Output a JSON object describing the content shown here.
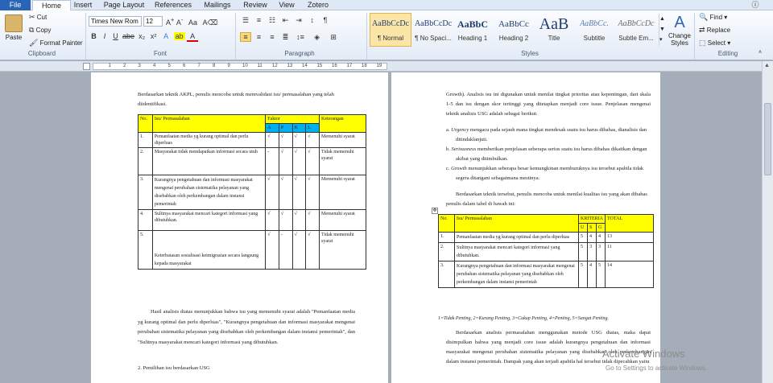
{
  "tabs": [
    "File",
    "Home",
    "Insert",
    "Page Layout",
    "References",
    "Mailings",
    "Review",
    "View",
    "Zotero"
  ],
  "clipboard": {
    "paste": "Paste",
    "cut": "Cut",
    "copy": "Copy",
    "format_painter": "Format Painter",
    "label": "Clipboard"
  },
  "font": {
    "name": "Times New Rom",
    "size": "12",
    "label": "Font"
  },
  "paragraph": {
    "label": "Paragraph"
  },
  "styles": {
    "items": [
      {
        "preview": "AaBbCcDc",
        "name": "¶ Normal"
      },
      {
        "preview": "AaBbCcDc",
        "name": "¶ No Spaci..."
      },
      {
        "preview": "AaBbC",
        "name": "Heading 1"
      },
      {
        "preview": "AaBbCc",
        "name": "Heading 2"
      },
      {
        "preview": "AaB",
        "name": "Title"
      },
      {
        "preview": "AaBbCc.",
        "name": "Subtitle"
      },
      {
        "preview": "AaBbCcDc",
        "name": "Subtle Em..."
      }
    ],
    "change": "Change Styles",
    "label": "Styles"
  },
  "editing": {
    "find": "Find",
    "replace": "Replace",
    "select": "Select",
    "label": "Editing"
  },
  "left_page": {
    "intro": "Berdasarkan  teknik AKPL, penulis mencoba untuk memvalidasi isu/ permasalahan yang telah diidentifikasi.",
    "table": {
      "headers": [
        "No.",
        "Isu/ Permasalahan",
        "Faktor",
        "Keterangan"
      ],
      "factors": [
        "A",
        "P",
        "K",
        "L"
      ],
      "rows": [
        {
          "no": "1.",
          "issue": "Pemanfaatan  media yg kurang  optimal dan perlu diperluas",
          "marks": [
            "√",
            "√",
            "√",
            "√"
          ],
          "note": "Memenuhi syarat"
        },
        {
          "no": "2.",
          "issue": "Masyarakat  tidak mendapatkan  informasi secara  utuh",
          "marks": [
            "-",
            "√",
            "√",
            "√"
          ],
          "note": "Tidak memenuhi syarat"
        },
        {
          "no": "3.",
          "issue": "Kurangnya pengetahuan  dan informasi masyarakat  mengenai  perubahan sistematika pelayanan  yang disebabkan oleh perkembangan  dalam  instansi pemerintah",
          "marks": [
            "√",
            "√",
            "√",
            "√"
          ],
          "note": "Memenuhi syarat"
        },
        {
          "no": "4.",
          "issue": "Sulitnya masyarakat  mencari  kategori informasi  yang dibutuhkan.",
          "marks": [
            "√",
            "√",
            "√",
            "√"
          ],
          "note": "Memenuhi syarat"
        },
        {
          "no": "5.",
          "issue": "Keterbatasan  sosialisasi keimigrasian secara  langsung kepada  masyarakat",
          "marks": [
            "√",
            "-",
            "√",
            "√"
          ],
          "note": "Tidak memenuhi syarat"
        }
      ]
    },
    "analysis": "Hasil  analisis  diatas  menunjukkan  bahwa  isu  yang  memenuhi  syarat  adalah \"Pemanfaatan media yg kurang optimal dan perlu diperluas\", \"Kurangnya pengetahuan dan informasi masyarakat mengenai perubahan sistematika pelayanan yang disebabkan oleh perkembangan dalam instansi pemerintah\", dan  \"Sulitnya masyarakat mencari kategori informasi yang dibutuhkan.",
    "heading": "2.   Pemilihan isu berdasarkan  USG"
  },
  "right_page": {
    "intro": "Growth). Analisis isu ini digunakan untuk menilai tingkat prioritas atau kepentingan, dari skala 1-5 dan isu dengan skor tertinggi yang ditetapkan menjadi core issue. Penjelasan mengenai teknik analisis USG adalah sebagai berikut:",
    "list": [
      {
        "marker": "a.",
        "term": "Urgency",
        "text": " mengacu pada sejauh mana tingkat mendesak suatu isu harus dibahas, dianalisis dan ditindaklanjuti."
      },
      {
        "marker": "b.",
        "term": "Seriousness",
        "text": " memberikan penjelasan seberapa serius suatu isu harus dibahas dikaitkan dengan akibat yang ditimbulkan."
      },
      {
        "marker": "c.",
        "term": "Growth",
        "text": " menunjukkan seberapa besar kemungkinan memburuknya isu tersebut apabila tidak segera ditangani sebagaimana mestinya."
      }
    ],
    "para2": "Berdasarkan  teknik tersebut,  penulis mencoba  untuk menilai kualitas  isu yang akan dibahas penulis dalam tabel di bawah ini:",
    "table": {
      "headers": [
        "No.",
        "Isu/ Permasalahan",
        "KRITERIA",
        "TOTAL"
      ],
      "criteria": [
        "U",
        "S",
        "G"
      ],
      "rows": [
        {
          "no": "1.",
          "issue": "Pemanfaatan  media yg kurang  optimal dan perlu diperluas",
          "u": "5",
          "s": "4",
          "g": "4",
          "total": "13"
        },
        {
          "no": "2.",
          "issue": "Sulitnya masyarakat  mencari  kategori informasi  yang dibutuhkan.",
          "u": "5",
          "s": "3",
          "g": "3",
          "total": "11"
        },
        {
          "no": "3.",
          "issue": "Kurangnya  pengetahuan  dan informasi  masyarakat mengenai  perubahan  sistematika  pelayanan  yang disebabkan  oleh  perkembangan  dalam  instansi pemerintah",
          "u": "5",
          "s": "4",
          "g": "5",
          "total": "14"
        }
      ]
    },
    "legend": "1=Tidak Penting, 2=Kurang Penting, 3=Cukup Penting, 4=Penting, 5=Sangat Penting.",
    "para3": "Berdasarkan analisis permasalahan menggunakan metode USG diatas, maka dapat disimpulkan  bahwa  yang  menjadi  core issue  adalah  kurangnya  pengetahuan  dan informasi masyarakat mengenai perubahan sistematika pelayanan yang disebabkan oleh perkembangan  dalam  instansi  pemerintah.  Dampak  yang  akan  terjadi  apabila  hal tersebut tidak dipecahkan yaitu"
  },
  "watermark": {
    "line1": "Activate Windows",
    "line2": "Go to Settings to activate Windows."
  }
}
